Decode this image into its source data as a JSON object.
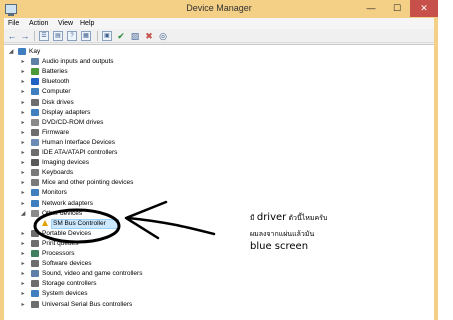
{
  "window": {
    "title": "Device Manager",
    "min_glyph": "—",
    "max_glyph": "☐",
    "close_glyph": "✕"
  },
  "menu": [
    "File",
    "Action",
    "View",
    "Help"
  ],
  "toolbar": {
    "back_icon": "arrow-left-icon",
    "forward_icon": "arrow-right-icon"
  },
  "tree": {
    "root": "Kay",
    "items": [
      {
        "label": "Audio inputs and outputs",
        "icon": "speaker-icon",
        "color": "#5d7fa8"
      },
      {
        "label": "Batteries",
        "icon": "battery-icon",
        "color": "#4a9a3a"
      },
      {
        "label": "Bluetooth",
        "icon": "bluetooth-icon",
        "color": "#1e63c4"
      },
      {
        "label": "Computer",
        "icon": "computer-icon",
        "color": "#3f7fbf"
      },
      {
        "label": "Disk drives",
        "icon": "disk-icon",
        "color": "#6d6d6d"
      },
      {
        "label": "Display adapters",
        "icon": "display-icon",
        "color": "#3f7fbf"
      },
      {
        "label": "DVD/CD-ROM drives",
        "icon": "dvd-icon",
        "color": "#8a8a8a"
      },
      {
        "label": "Firmware",
        "icon": "firmware-icon",
        "color": "#6d6d6d"
      },
      {
        "label": "Human Interface Devices",
        "icon": "hid-icon",
        "color": "#6a8cb5"
      },
      {
        "label": "IDE ATA/ATAPI controllers",
        "icon": "controller-icon",
        "color": "#6d6d6d"
      },
      {
        "label": "Imaging devices",
        "icon": "camera-icon",
        "color": "#5a5a5a"
      },
      {
        "label": "Keyboards",
        "icon": "keyboard-icon",
        "color": "#7a7a7a"
      },
      {
        "label": "Mice and other pointing devices",
        "icon": "mouse-icon",
        "color": "#7a7a7a"
      },
      {
        "label": "Monitors",
        "icon": "monitor-icon",
        "color": "#3f7fbf"
      },
      {
        "label": "Network adapters",
        "icon": "network-icon",
        "color": "#3f7fbf"
      },
      {
        "label": "Other devices",
        "icon": "unknown-device-icon",
        "color": "#8a8a8a",
        "expanded": true
      },
      {
        "label": "SM Bus Controller",
        "icon": "warning-icon",
        "color": "#e0a000",
        "child": true,
        "selected": true
      },
      {
        "label": "Portable Devices",
        "icon": "portable-icon",
        "color": "#6d6d6d"
      },
      {
        "label": "Print queues",
        "icon": "printer-icon",
        "color": "#6d6d6d"
      },
      {
        "label": "Processors",
        "icon": "processor-icon",
        "color": "#3f7f5f"
      },
      {
        "label": "Software devices",
        "icon": "software-icon",
        "color": "#6d6d6d"
      },
      {
        "label": "Sound, video and game controllers",
        "icon": "sound-icon",
        "color": "#5d7fa8"
      },
      {
        "label": "Storage controllers",
        "icon": "storage-icon",
        "color": "#6d6d6d"
      },
      {
        "label": "System devices",
        "icon": "system-icon",
        "color": "#3f7fbf"
      },
      {
        "label": "Universal Serial Bus controllers",
        "icon": "usb-icon",
        "color": "#6d6d6d"
      }
    ]
  },
  "annotation": {
    "line1_latin": "driver",
    "line1_pre": "มี ",
    "line1_post": " ตัวนี้ไหมครับ",
    "line2": "ผมลงจากแผ่นแล้วมัน",
    "line3": "blue screen",
    "ink_color": "#000000"
  }
}
